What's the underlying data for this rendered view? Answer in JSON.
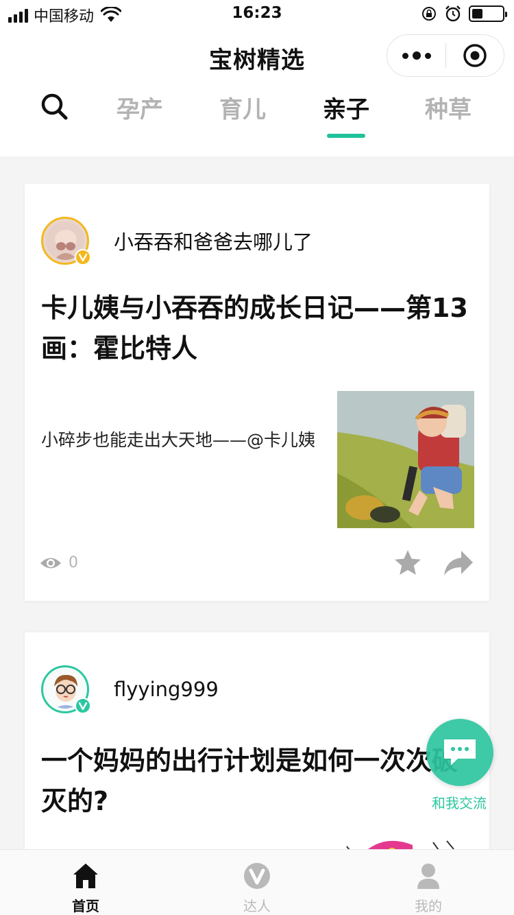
{
  "status_bar": {
    "carrier": "中国移动",
    "time": "16:23",
    "battery_level": 0.35
  },
  "header": {
    "title": "宝树精选",
    "tabs": [
      {
        "label": "孕产",
        "active": false
      },
      {
        "label": "育儿",
        "active": false
      },
      {
        "label": "亲子",
        "active": true
      },
      {
        "label": "种草",
        "active": false
      }
    ],
    "accent_color": "#1fc19a"
  },
  "feed": [
    {
      "author": "小吞吞和爸爸去哪儿了",
      "title": "卡儿姨与小吞吞的成长日记——第13画：霍比特人",
      "excerpt": "小碎步也能走出大天地——@卡儿姨",
      "views": "0",
      "verify_color": "#f3b81e"
    },
    {
      "author": "flyying999",
      "title": "一个妈妈的出行计划是如何一次次破灭的?",
      "verify_color": "#2cc7a0"
    }
  ],
  "chat_fab": {
    "label": "和我交流"
  },
  "tabbar": {
    "items": [
      {
        "label": "首页",
        "icon": "home-icon",
        "active": true
      },
      {
        "label": "达人",
        "icon": "expert-v-icon",
        "active": false
      },
      {
        "label": "我的",
        "icon": "profile-icon",
        "active": false
      }
    ]
  }
}
